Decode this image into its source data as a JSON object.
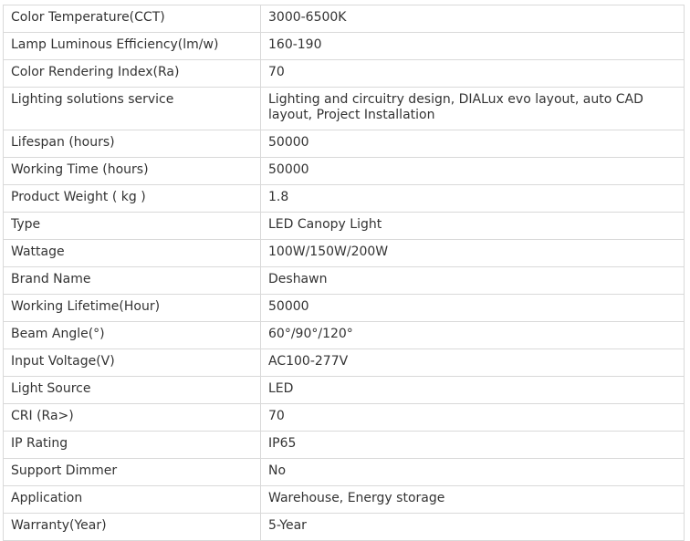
{
  "spec_table": {
    "rows": [
      {
        "label": "Color Temperature(CCT)",
        "value": "3000-6500K"
      },
      {
        "label": "Lamp Luminous Efficiency(lm/w)",
        "value": "160-190"
      },
      {
        "label": "Color Rendering Index(Ra)",
        "value": "70"
      },
      {
        "label": "Lighting solutions service",
        "value": "Lighting and circuitry design, DIALux evo layout, auto CAD layout, Project Installation"
      },
      {
        "label": "Lifespan (hours)",
        "value": "50000"
      },
      {
        "label": "Working Time (hours)",
        "value": "50000"
      },
      {
        "label": "Product Weight ( kg )",
        "value": "1.8"
      },
      {
        "label": "Type",
        "value": "LED Canopy Light"
      },
      {
        "label": "Wattage",
        "value": "100W/150W/200W"
      },
      {
        "label": "Brand Name",
        "value": "Deshawn"
      },
      {
        "label": "Working Lifetime(Hour)",
        "value": "50000"
      },
      {
        "label": "Beam Angle(°)",
        "value": "60°/90°/120°"
      },
      {
        "label": "Input Voltage(V)",
        "value": "AC100-277V"
      },
      {
        "label": "Light Source",
        "value": "LED"
      },
      {
        "label": "CRI (Ra>)",
        "value": "70"
      },
      {
        "label": "IP Rating",
        "value": "IP65"
      },
      {
        "label": "Support Dimmer",
        "value": "No"
      },
      {
        "label": "Application",
        "value": "Warehouse, Energy storage"
      },
      {
        "label": "Warranty(Year)",
        "value": "5-Year"
      }
    ]
  }
}
